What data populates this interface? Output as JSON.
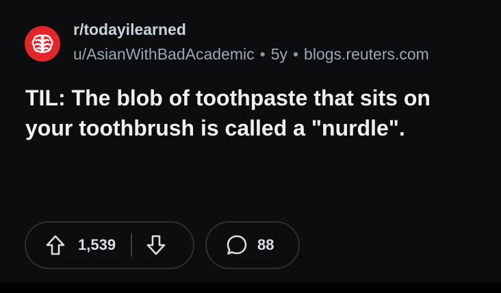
{
  "post": {
    "subreddit": "r/todayilearned",
    "author": "u/AsianWithBadAcademic",
    "age": "5y",
    "domain": "blogs.reuters.com",
    "separator": "•",
    "title": "TIL: The blob of toothpaste that sits on your toothbrush is called a \"nurdle\".",
    "subreddit_icon": "brain-icon",
    "accent_color": "#e4262b"
  },
  "actions": {
    "upvote_icon": "arrow-up-icon",
    "score": "1,539",
    "downvote_icon": "arrow-down-icon",
    "comment_icon": "comment-bubble-icon",
    "comment_count": "88"
  }
}
